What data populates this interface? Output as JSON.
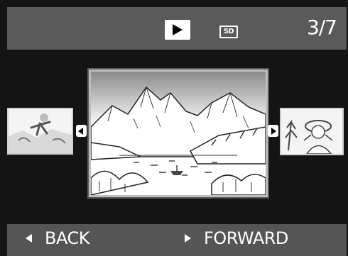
{
  "status": {
    "mode_icon": "play-icon",
    "card_icon": "sd-card-icon",
    "card_label": "SD",
    "counter": "3/7"
  },
  "gallery": {
    "previous_thumb": "previous-photo-thumbnail",
    "current_photo": "current-photo-mountain-lake",
    "next_thumb": "next-photo-thumbnail"
  },
  "footer": {
    "back_label": "BACK",
    "forward_label": "FORWARD"
  },
  "colors": {
    "bar_gray": "#5a5a5a",
    "background": "#141414",
    "text": "#ffffff"
  }
}
